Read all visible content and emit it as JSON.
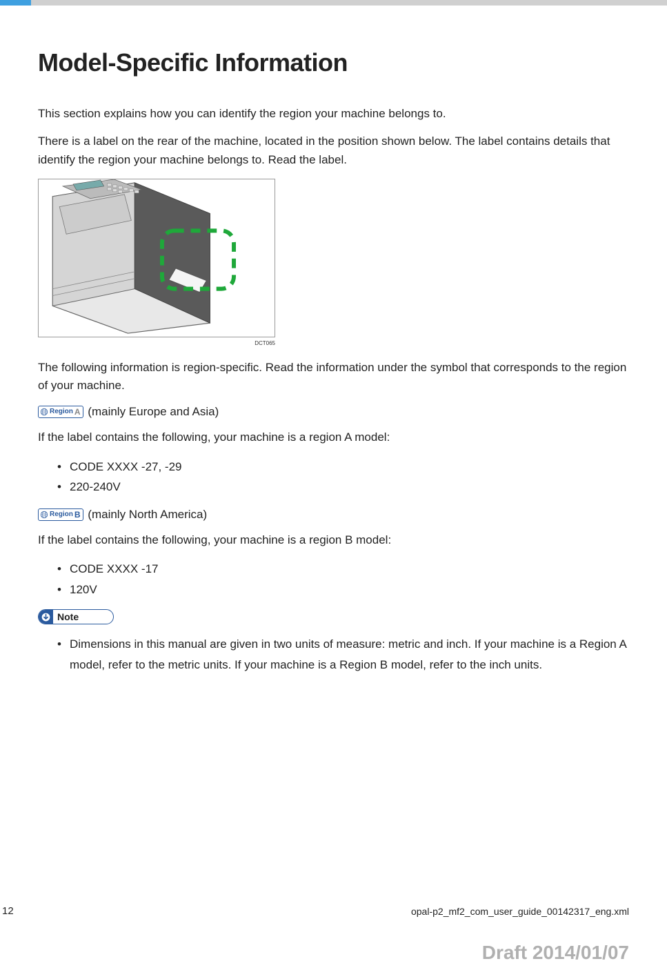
{
  "heading": "Model-Specific Information",
  "para1": "This section explains how you can identify the region your machine belongs to.",
  "para2": "There is a label on the rear of the machine, located in the position shown below. The label contains details that identify the region your machine belongs to. Read the label.",
  "figure_caption": "DCT065",
  "para3": "The following information is region-specific. Read the information under the symbol that corresponds to the region of your machine.",
  "region_a": {
    "badge_text": "Region",
    "badge_letter": "A",
    "desc": "(mainly Europe and Asia)",
    "intro": "If the label contains the following, your machine is a region A model:",
    "items": [
      "CODE XXXX -27, -29",
      "220-240V"
    ]
  },
  "region_b": {
    "badge_text": "Region",
    "badge_letter": "B",
    "desc": "(mainly North America)",
    "intro": "If the label contains the following, your machine is a region B model:",
    "items": [
      "CODE XXXX -17",
      "120V"
    ]
  },
  "note": {
    "label": "Note",
    "items": [
      "Dimensions in this manual are given in two units of measure: metric and inch. If your machine is a Region A model, refer to the metric units. If your machine is a Region B model, refer to the inch units."
    ]
  },
  "footer": {
    "page": "12",
    "filename": "opal-p2_mf2_com_user_guide_00142317_eng.xml",
    "draft": "Draft 2014/01/07"
  }
}
